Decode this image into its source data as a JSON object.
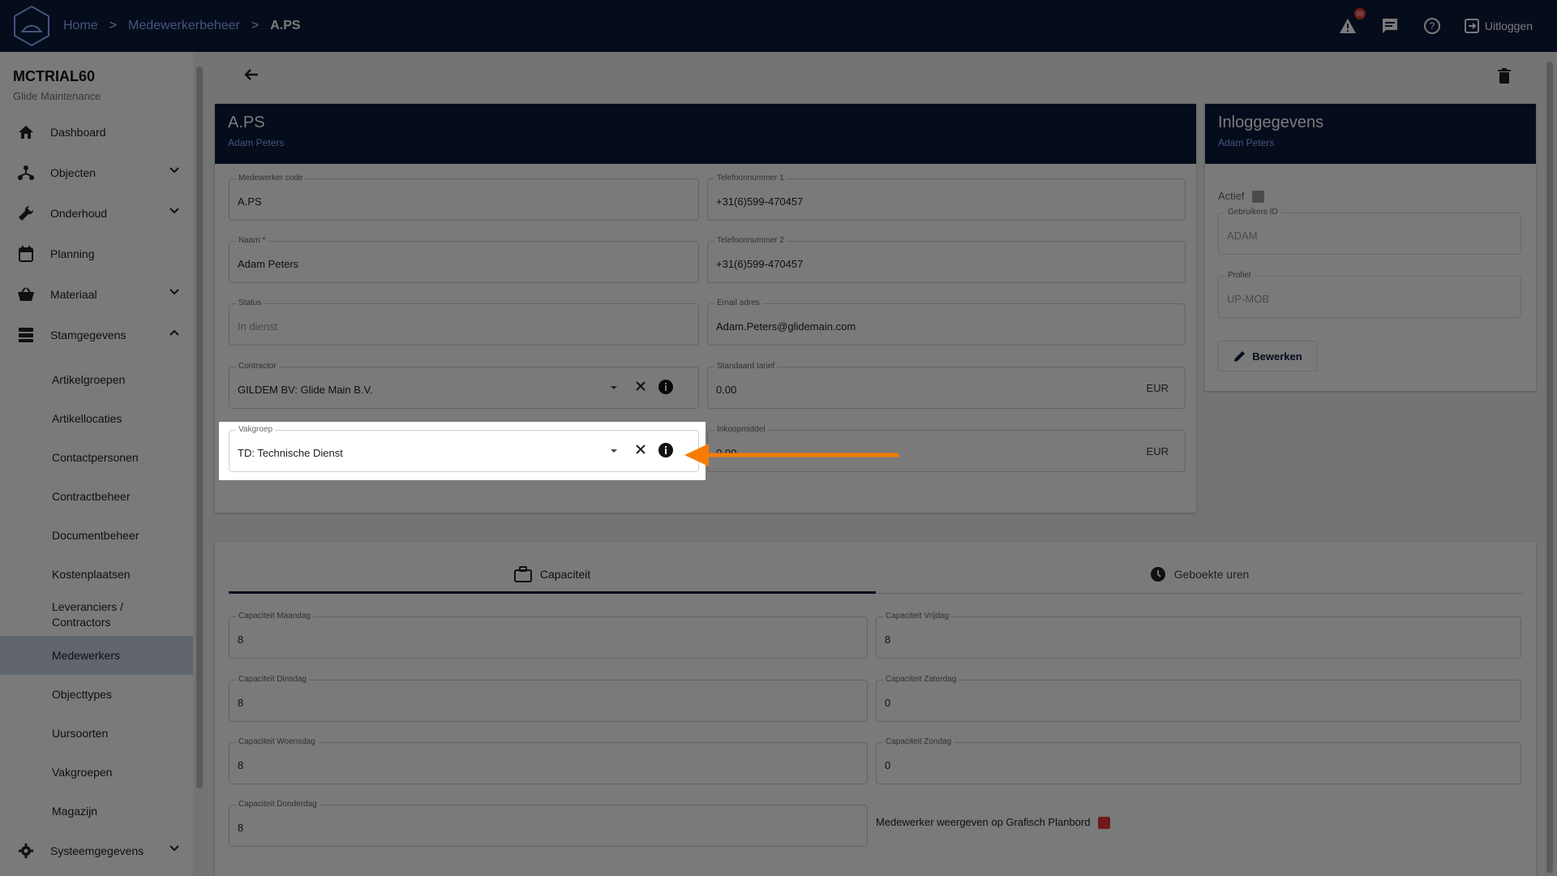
{
  "topbar": {
    "breadcrumb": [
      "Home",
      "Medewerkerbeheer",
      "A.PS"
    ],
    "separator": ">",
    "alert_count": "99",
    "logout_label": "Uitloggen"
  },
  "sidebar": {
    "company": "MCTRIAL60",
    "subtitle": "Glide Maintenance",
    "items": [
      {
        "label": "Dashboard",
        "icon": "home-icon"
      },
      {
        "label": "Objecten",
        "icon": "hierarchy-icon"
      },
      {
        "label": "Onderhoud",
        "icon": "wrench-icon"
      },
      {
        "label": "Planning",
        "icon": "calendar-icon"
      },
      {
        "label": "Materiaal",
        "icon": "basket-icon"
      },
      {
        "label": "Stamgegevens",
        "icon": "database-icon"
      }
    ],
    "sub_items": [
      "Artikelgroepen",
      "Artikellocaties",
      "Contactpersonen",
      "Contractbeheer",
      "Documentbeheer",
      "Kostenplaatsen",
      "Leveranciers / Contractors",
      "Medewerkers",
      "Objecttypes",
      "Uursoorten",
      "Vakgroepen",
      "Magazijn"
    ],
    "bottom_item": {
      "label": "Systeemgegevens",
      "icon": "gear-icon"
    }
  },
  "employee": {
    "code_title": "A.PS",
    "name_sub": "Adam Peters",
    "fields": {
      "code": {
        "label": "Medewerker code",
        "value": "A.PS"
      },
      "name": {
        "label": "Naam *",
        "value": "Adam Peters"
      },
      "status": {
        "label": "Status",
        "value": "In dienst"
      },
      "contractor": {
        "label": "Contractor",
        "value": "GILDEM BV: Glide Main B.V."
      },
      "vakgroep": {
        "label": "Vakgroep",
        "value": "TD: Technische Dienst"
      },
      "phone1": {
        "label": "Telefoonnummer 1",
        "value": "+31(6)599-470457"
      },
      "phone2": {
        "label": "Telefoonnummer 2",
        "value": "+31(6)599-470457"
      },
      "email": {
        "label": "Email adres",
        "value": "Adam.Peters@glidemain.com"
      },
      "rate": {
        "label": "Standaard tarief",
        "value": "0.00",
        "unit": "EUR"
      },
      "purchase": {
        "label": "Inkoopmiddel",
        "value": "0.00",
        "unit": "EUR"
      }
    }
  },
  "login": {
    "title": "Inloggegevens",
    "sub": "Adam Peters",
    "active_label": "Actief",
    "user_id": {
      "label": "Gebruikers ID",
      "value": "ADAM"
    },
    "profile": {
      "label": "Profiel",
      "value": "UP-MOB"
    },
    "edit_label": "Bewerken"
  },
  "tabs": {
    "capacity": "Capaciteit",
    "booked": "Geboekte uren"
  },
  "capacity": {
    "monday": {
      "label": "Capaciteit Maandag",
      "value": "8"
    },
    "tuesday": {
      "label": "Capaciteit Dinsdag",
      "value": "8"
    },
    "wednesday": {
      "label": "Capaciteit Woensdag",
      "value": "8"
    },
    "thursday": {
      "label": "Capaciteit Donderdag",
      "value": "8"
    },
    "friday": {
      "label": "Capaciteit Vrijdag",
      "value": "8"
    },
    "saturday": {
      "label": "Capaciteit Zaterdag",
      "value": "0"
    },
    "sunday": {
      "label": "Capaciteit Zondag",
      "value": "0"
    },
    "planboard_label": "Medewerker weergeven op Grafisch Planbord"
  },
  "colors": {
    "navy": "#0c1a3b",
    "accent": "#f57c00",
    "link": "#8fb0ff",
    "checkbox_red": "#e53935"
  }
}
